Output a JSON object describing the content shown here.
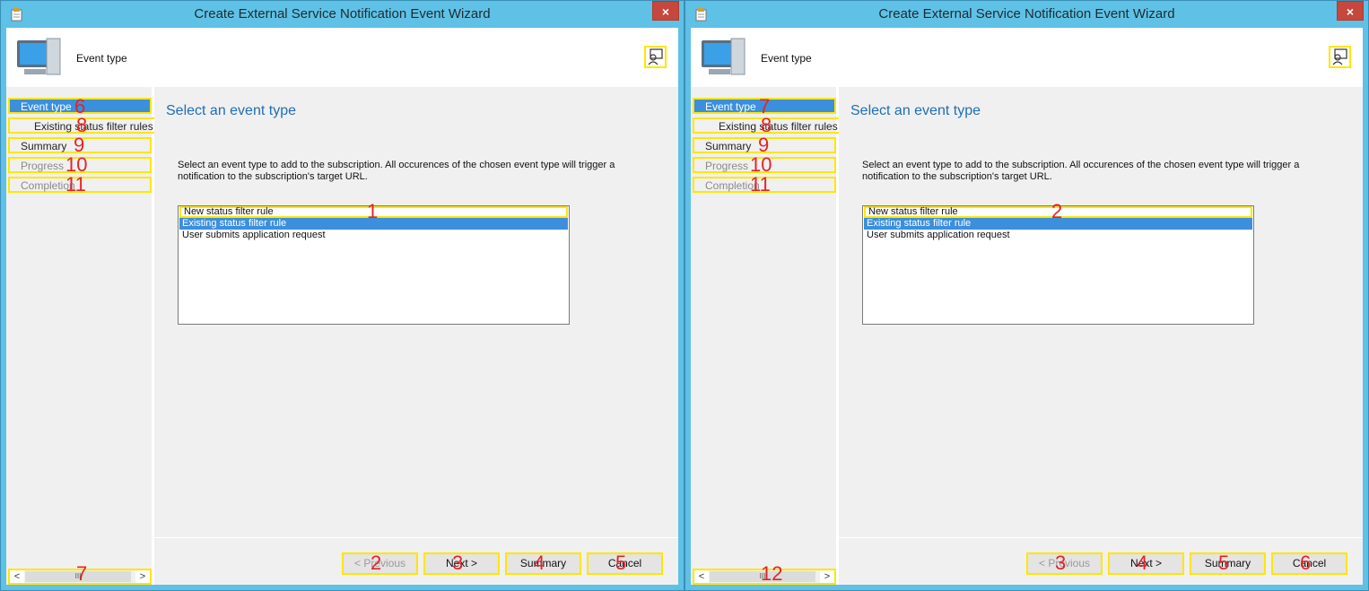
{
  "windows": [
    {
      "title": "Create External Service Notification Event Wizard",
      "close_glyph": "×",
      "header_title": "Event type",
      "nav": [
        {
          "label": "Event type",
          "marker": "6"
        },
        {
          "label": "Existing status filter rules",
          "marker": "8"
        },
        {
          "label": "Summary",
          "marker": "9"
        },
        {
          "label": "Progress",
          "marker": "10"
        },
        {
          "label": "Completion",
          "marker": "11"
        }
      ],
      "scroll_marker": "7",
      "page_title": "Select an event type",
      "description": "Select an event type to add to the subscription. All occurences of the chosen event type will trigger a notification to the subscription's target URL.",
      "list": [
        "New status filter rule",
        "Existing status filter rule",
        "User submits application request"
      ],
      "list_marker": "1",
      "buttons": [
        {
          "label": "< Previous",
          "marker": "2"
        },
        {
          "label": "Next >",
          "marker": "3"
        },
        {
          "label": "Summary",
          "marker": "4"
        },
        {
          "label": "Cancel",
          "marker": "5"
        }
      ]
    },
    {
      "title": "Create External Service Notification Event Wizard",
      "close_glyph": "×",
      "header_title": "Event type",
      "nav": [
        {
          "label": "Event type",
          "marker": "7"
        },
        {
          "label": "Existing status filter rules",
          "marker": "8"
        },
        {
          "label": "Summary",
          "marker": "9"
        },
        {
          "label": "Progress",
          "marker": "10"
        },
        {
          "label": "Completion",
          "marker": "11"
        }
      ],
      "scroll_marker": "12",
      "page_title": "Select an event type",
      "description": "Select an event type to add to the subscription. All occurences of the chosen event type will trigger a notification to the subscription's target URL.",
      "list": [
        "New status filter rule",
        "Existing status filter rule",
        "User submits application request"
      ],
      "list_marker": "2",
      "buttons": [
        {
          "label": "< Previous",
          "marker": "3"
        },
        {
          "label": "Next >",
          "marker": "4"
        },
        {
          "label": "Summary",
          "marker": "5"
        },
        {
          "label": "Cancel",
          "marker": "6"
        }
      ]
    }
  ],
  "scroll_thumb_glyph": "III",
  "scroll_left_glyph": "<",
  "scroll_right_glyph": ">",
  "colors": {
    "titlebar": "#5fc1e6",
    "selection": "#3b8fdd",
    "annotation": "#e0242a",
    "highlight_box": "#ffe600",
    "page_title": "#1f6fb5"
  }
}
